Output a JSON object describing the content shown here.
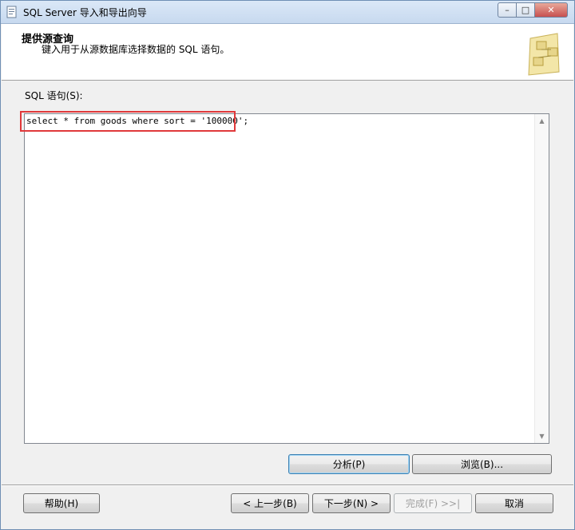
{
  "window": {
    "title": "SQL Server 导入和导出向导",
    "controls": {
      "minimize": "–",
      "maximize": "□",
      "close": "✕"
    }
  },
  "header": {
    "title": "提供源查询",
    "subtitle": "键入用于从源数据库选择数据的 SQL 语句。"
  },
  "sql": {
    "label": "SQL 语句(S):",
    "query": "select * from goods where sort = '100000';",
    "scroll_up": "▲",
    "scroll_down": "▼"
  },
  "buttons": {
    "parse": "分析(P)",
    "browse": "浏览(B)...",
    "help": "帮助(H)",
    "back": "< 上一步(B)",
    "next": "下一步(N) >",
    "finish": "完成(F) >>|",
    "cancel": "取消"
  },
  "colors": {
    "highlight_box": "#e0393b",
    "title_bar": "#c7d9ef"
  }
}
